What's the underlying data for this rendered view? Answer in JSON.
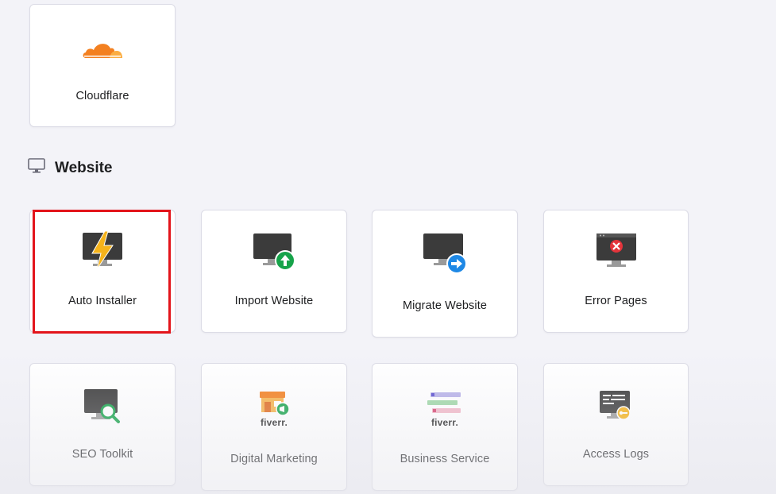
{
  "top_cards": [
    {
      "label": "Cloudflare",
      "icon": "cloudflare-icon"
    }
  ],
  "section": {
    "title": "Website",
    "icon": "monitor-icon"
  },
  "cards_row1": [
    {
      "label": "Auto Installer",
      "icon": "lightning-monitor-icon"
    },
    {
      "label": "Import Website",
      "icon": "import-monitor-icon"
    },
    {
      "label": "Migrate Website",
      "icon": "migrate-monitor-icon"
    },
    {
      "label": "Error Pages",
      "icon": "error-monitor-icon"
    }
  ],
  "cards_row2": [
    {
      "label": "SEO Toolkit",
      "icon": "seo-monitor-icon"
    },
    {
      "label": "Digital Marketing",
      "icon": "fiverr-store-icon",
      "brand": "fiverr."
    },
    {
      "label": "Business Service",
      "icon": "fiverr-list-icon",
      "brand": "fiverr."
    },
    {
      "label": "Access Logs",
      "icon": "access-logs-icon"
    }
  ],
  "colors": {
    "highlight": "#e3141b",
    "cloudflare_orange": "#f38020",
    "cloudflare_light": "#fbad41",
    "lightning": "#f5b31b",
    "green": "#16a34a",
    "blue": "#1e88e5",
    "red": "#e3343b",
    "monitor": "#3b3b3b"
  }
}
